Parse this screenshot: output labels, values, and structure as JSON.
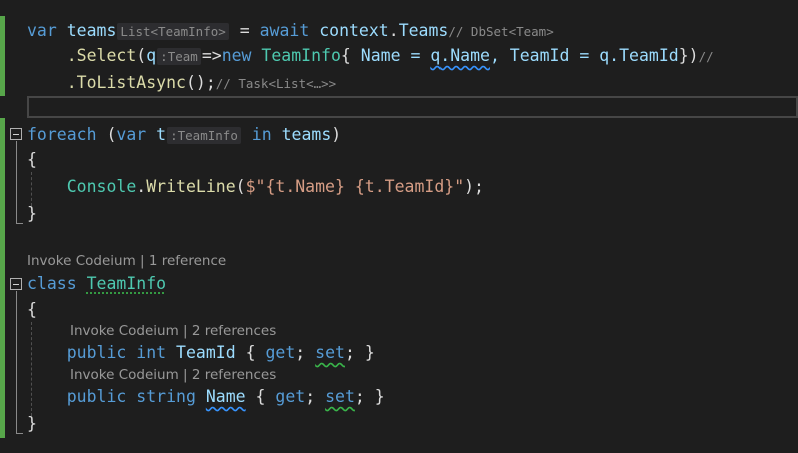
{
  "code": {
    "l1": {
      "var": "var",
      "teams": "teams",
      "hint_type": "List<TeamInfo>",
      "eq": " = ",
      "await": "await",
      "context": " context",
      "dot": ".",
      "Teams": "Teams",
      "comment": "// DbSet<Team>"
    },
    "l2": {
      "dot_select": ".Select",
      "open": "(",
      "q": "q",
      "hint_q": ":Team",
      "arrow": "=>",
      "new": "new",
      "TeamInfo": " TeamInfo",
      "brace_open": "{",
      "name_assign": " Name = ",
      "q1": "q",
      "name_prop": ".Name",
      "comma": ", TeamId = q.",
      "teamid_prop": "TeamId",
      "brace_close": "})",
      "comment": "// "
    },
    "l3": {
      "call": ".ToListAsync",
      "rest": "();",
      "comment": "// Task<List<…>>"
    },
    "l5": {
      "foreach": "foreach",
      "open": " (",
      "var": "var",
      "t": " t",
      "hint_t": ":TeamInfo",
      "in": "in",
      "teams": " teams",
      "close": ")"
    },
    "l6": {
      "brace": "{"
    },
    "l7": {
      "console": "Console",
      "dot": ".",
      "writeline": "WriteLine",
      "open": "(",
      "str": "$\"{t.Name} {t.TeamId}\"",
      "close": ");"
    },
    "l8": {
      "brace": "}"
    },
    "lens_class": "Invoke Codeium | 1 reference",
    "l9": {
      "class": "class",
      "name": "TeamInfo"
    },
    "l10": {
      "brace": "{"
    },
    "lens_teamid": "Invoke Codeium | 2 references",
    "l11": {
      "public": "public",
      "int": "int",
      "prop": "TeamId",
      "open": " { ",
      "get": "get",
      "semi1": "; ",
      "set": "set",
      "close": "; }"
    },
    "lens_name": "Invoke Codeium | 2 references",
    "l12": {
      "public": "public",
      "string": "string",
      "prop": "Name",
      "open": " { ",
      "get": "get",
      "semi1": "; ",
      "set": "set",
      "close": "; }"
    },
    "l13": {
      "brace": "}"
    }
  },
  "colors": {
    "background": "#1e1e1e",
    "keyword": "#569cd6",
    "type": "#4ec9b0",
    "identifier": "#9cdcfe",
    "method": "#dcdcaa",
    "string": "#d69d85",
    "change_bar": "#57a64a"
  },
  "icons": [
    "fold-collapse-icon"
  ]
}
